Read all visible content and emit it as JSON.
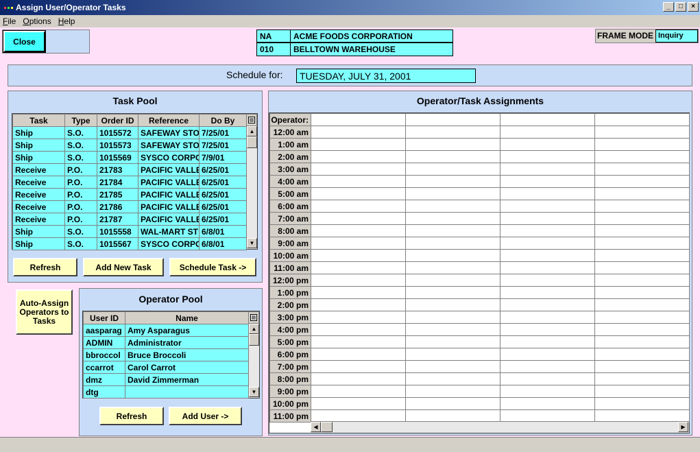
{
  "window": {
    "title": "Assign User/Operator Tasks",
    "minimize": "_",
    "maximize": "□",
    "close": "×"
  },
  "menu": [
    {
      "label": "File",
      "accel": "F",
      "rest": "ile"
    },
    {
      "label": "Options",
      "accel": "O",
      "rest": "ptions"
    },
    {
      "label": "Help",
      "accel": "H",
      "rest": "elp"
    }
  ],
  "close_button": "Close",
  "company": {
    "code": "NA",
    "name": "ACME FOODS CORPORATION",
    "wh_code": "010",
    "wh_name": "BELLTOWN WAREHOUSE"
  },
  "frame_mode": {
    "label": "FRAME MODE",
    "value": "Inquiry"
  },
  "schedule": {
    "label": "Schedule for:",
    "date": "TUESDAY, JULY 31, 2001"
  },
  "task_pool": {
    "title": "Task Pool",
    "columns": [
      "Task",
      "Type",
      "Order ID",
      "Reference",
      "Do By"
    ],
    "rows": [
      [
        "Ship",
        "S.O.",
        "1015572",
        "SAFEWAY STO",
        "7/25/01"
      ],
      [
        "Ship",
        "S.O.",
        "1015573",
        "SAFEWAY STO",
        "7/25/01"
      ],
      [
        "Ship",
        "S.O.",
        "1015569",
        "SYSCO CORPO",
        "7/9/01"
      ],
      [
        "Receive",
        "P.O.",
        "21783",
        "PACIFIC VALLE",
        "6/25/01"
      ],
      [
        "Receive",
        "P.O.",
        "21784",
        "PACIFIC VALLE",
        "6/25/01"
      ],
      [
        "Receive",
        "P.O.",
        "21785",
        "PACIFIC VALLE",
        "6/25/01"
      ],
      [
        "Receive",
        "P.O.",
        "21786",
        "PACIFIC VALLE",
        "6/25/01"
      ],
      [
        "Receive",
        "P.O.",
        "21787",
        "PACIFIC VALLE",
        "6/25/01"
      ],
      [
        "Ship",
        "S.O.",
        "1015558",
        "WAL-MART ST",
        "6/8/01"
      ],
      [
        "Ship",
        "S.O.",
        "1015567",
        "SYSCO CORPO",
        "6/8/01"
      ]
    ],
    "buttons": {
      "refresh": "Refresh",
      "add": "Add New Task",
      "schedule": "Schedule Task ->"
    }
  },
  "auto_assign": "Auto-Assign Operators to Tasks",
  "operator_pool": {
    "title": "Operator Pool",
    "columns": [
      "User ID",
      "Name"
    ],
    "rows": [
      [
        "aasparag",
        "Amy Asparagus"
      ],
      [
        "ADMIN",
        "Administrator"
      ],
      [
        "bbroccol",
        "Bruce Broccoli"
      ],
      [
        "ccarrot",
        "Carol Carrot"
      ],
      [
        "dmz",
        "David Zimmerman"
      ],
      [
        "dtg",
        ""
      ]
    ],
    "buttons": {
      "refresh": "Refresh",
      "add": "Add User ->"
    }
  },
  "assignments": {
    "title": "Operator/Task Assignments",
    "operator_label": "Operator:",
    "times": [
      "12:00 am",
      "1:00 am",
      "2:00 am",
      "3:00 am",
      "4:00 am",
      "5:00 am",
      "6:00 am",
      "7:00 am",
      "8:00 am",
      "9:00 am",
      "10:00 am",
      "11:00 am",
      "12:00 pm",
      "1:00 pm",
      "2:00 pm",
      "3:00 pm",
      "4:00 pm",
      "5:00 pm",
      "6:00 pm",
      "7:00 pm",
      "8:00 pm",
      "9:00 pm",
      "10:00 pm",
      "11:00 pm"
    ]
  }
}
